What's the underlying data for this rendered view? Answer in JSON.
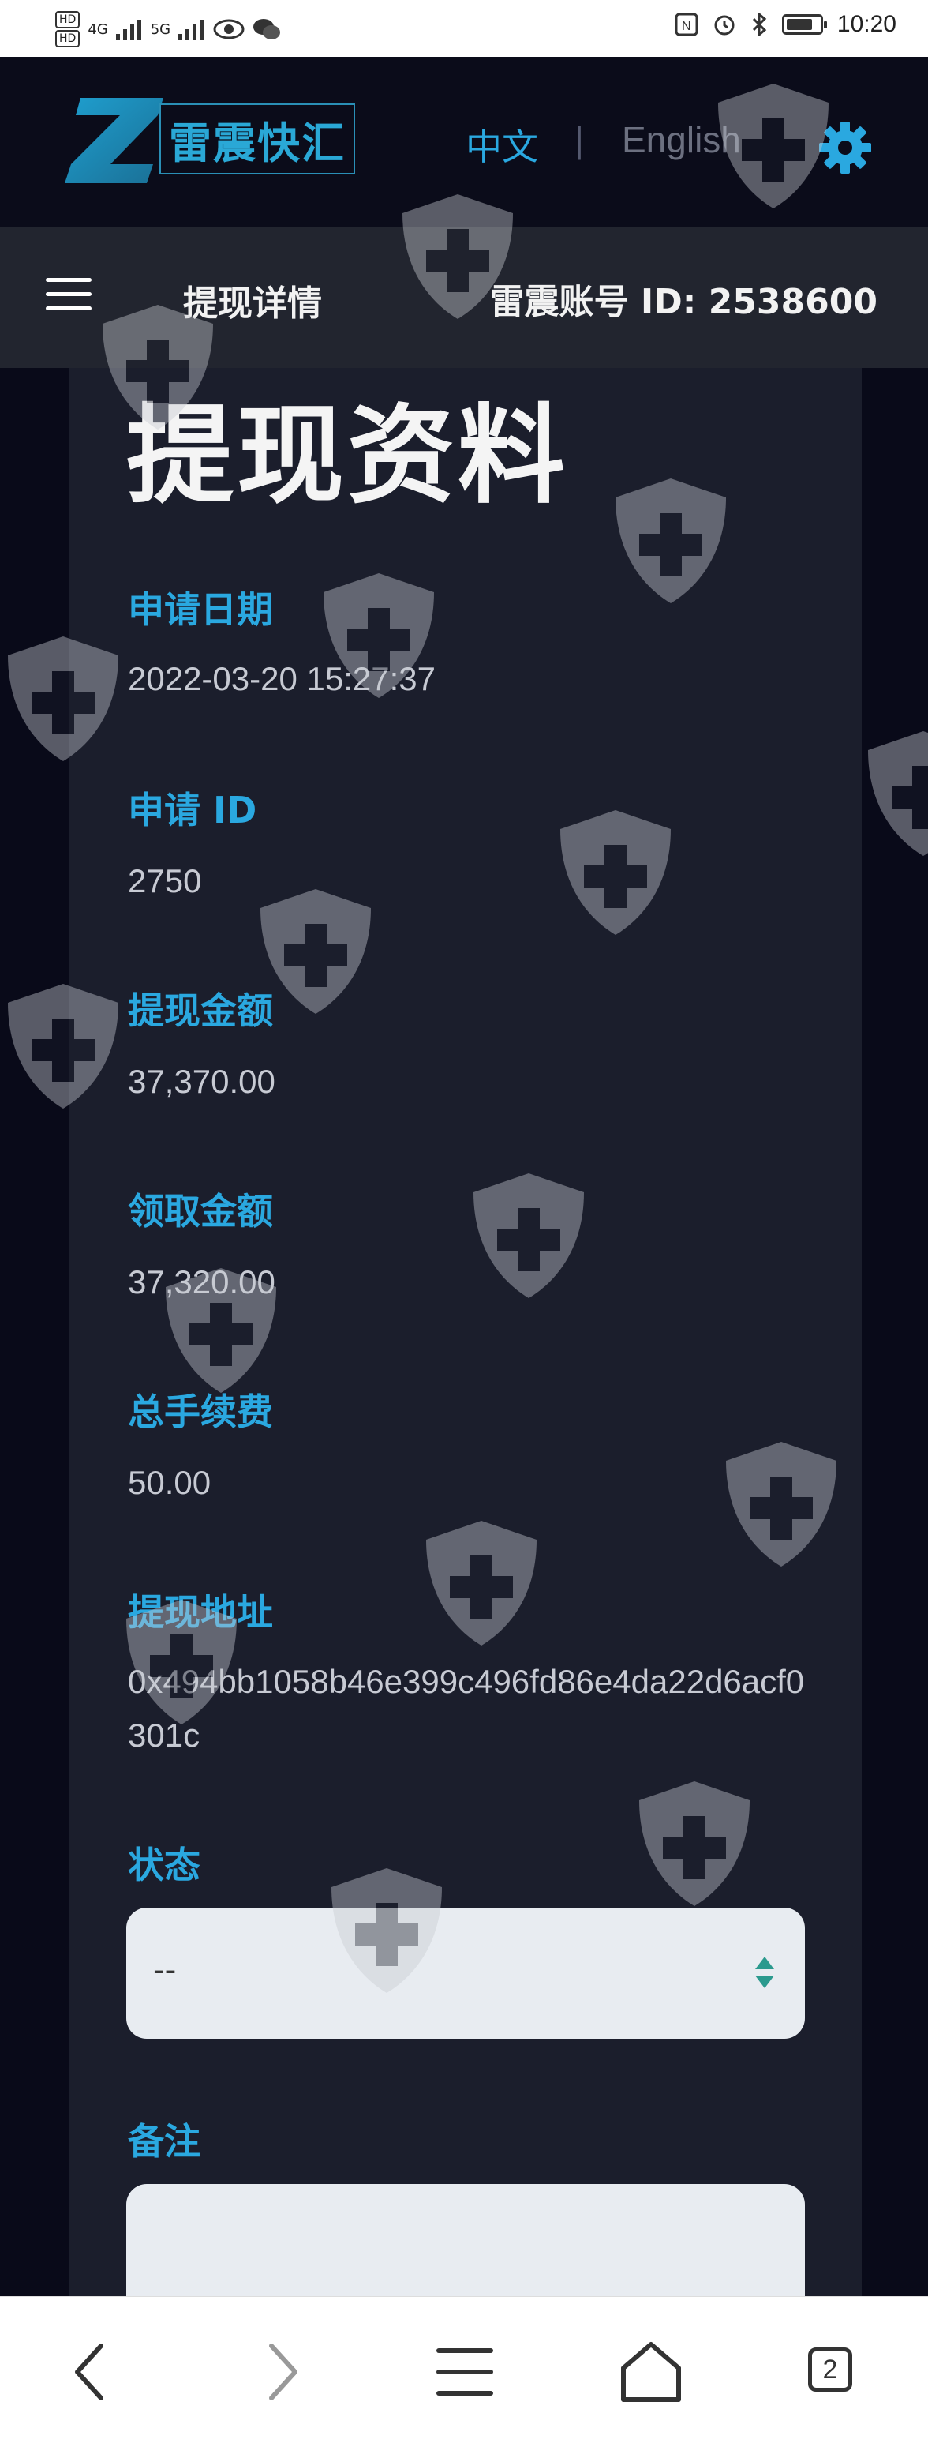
{
  "status_bar": {
    "left_badges": [
      "HD",
      "HD"
    ],
    "signal1": "4G",
    "signal2": "5G",
    "time": "10:20",
    "battery_level": 0.8
  },
  "header": {
    "logo_text": "雷震快汇",
    "lang_zh": "中文",
    "lang_sep": "|",
    "lang_en": "English",
    "settings_icon": "gear-icon"
  },
  "nav": {
    "menu_icon": "hamburger-icon",
    "title": "提现详情",
    "account": "雷震账号 ID: 2538600"
  },
  "main": {
    "title": "提现资料",
    "fields": [
      {
        "label": "申请日期",
        "value": "2022-03-20 15:27:37"
      },
      {
        "label": "申请 ID",
        "value": "2750"
      },
      {
        "label": "提现金额",
        "value": "37,370.00"
      },
      {
        "label": "领取金额",
        "value": "37,320.00"
      },
      {
        "label": "总手续费",
        "value": "50.00"
      },
      {
        "label": "提现地址",
        "value": "0x494bb1058b46e399c496fd86e4da22d6acf0301c"
      }
    ],
    "status_label": "状态",
    "status_value": "--",
    "remark_label": "备注",
    "remark_value": ""
  },
  "browser_bar": {
    "tab_count": "2",
    "icons": [
      "back-icon",
      "forward-icon",
      "menu-icon",
      "home-icon",
      "tabs-icon"
    ]
  },
  "colors": {
    "accent": "#2aa8e0",
    "background": "#0b0c1a",
    "card": "#1b1e2c",
    "navbar": "#22252f"
  }
}
